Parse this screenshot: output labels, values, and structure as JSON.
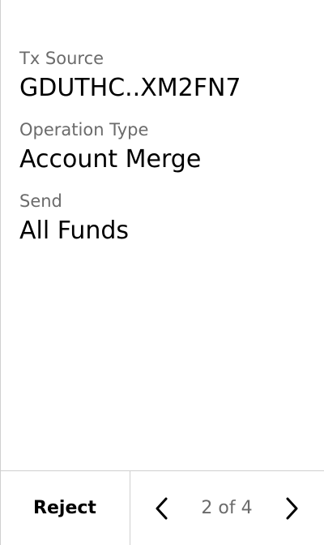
{
  "fields": [
    {
      "label": "Tx Source",
      "value": "GDUTHC..XM2FN7"
    },
    {
      "label": "Operation Type",
      "value": "Account Merge"
    },
    {
      "label": "Send",
      "value": "All Funds"
    }
  ],
  "footer": {
    "reject_label": "Reject",
    "page_indicator": "2 of 4",
    "prev_icon": "chevron-left-icon",
    "next_icon": "chevron-right-icon"
  }
}
